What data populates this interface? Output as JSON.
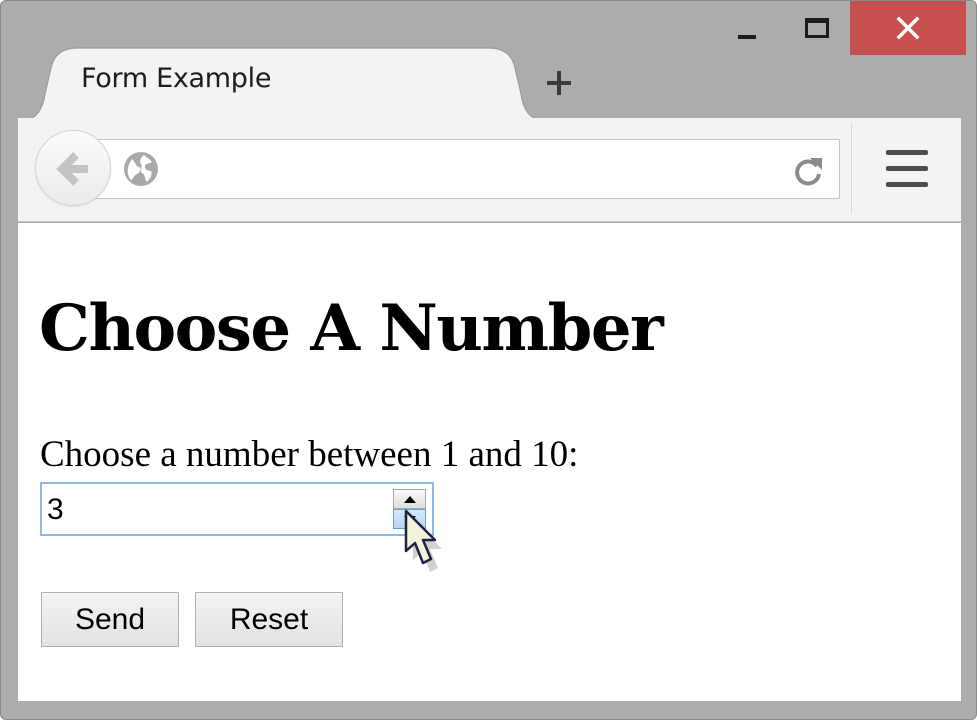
{
  "window": {
    "tab_title": "Form Example",
    "new_tab_symbol": "+",
    "close_symbol": "✕",
    "close_color": "#c7504f"
  },
  "toolbar": {
    "address_value": ""
  },
  "page": {
    "heading": "Choose A Number",
    "field_label": "Choose a number between 1 and 10:",
    "number_value": "3",
    "send_label": "Send",
    "reset_label": "Reset"
  },
  "icons": {
    "back": "arrow-left-icon",
    "site": "globe-icon",
    "reload": "reload-icon",
    "menu": "hamburger-menu-icon",
    "minimize": "minimize-icon",
    "maximize": "maximize-icon",
    "close": "close-icon",
    "spin_up": "triangle-up-icon",
    "spin_down": "triangle-down-icon",
    "cursor": "mouse-pointer-icon"
  }
}
